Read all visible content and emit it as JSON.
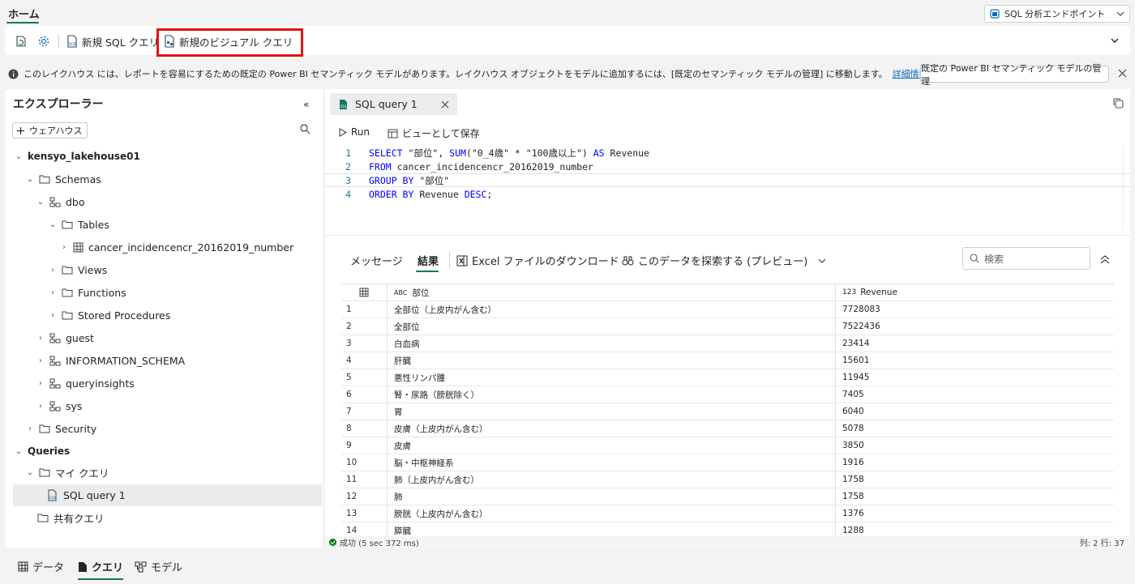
{
  "header": {
    "home_tab": "ホーム",
    "endpoint_label": "SQL 分析エンドポイント"
  },
  "ribbon": {
    "new_sql_query": "新規 SQL クエリ",
    "new_visual_query": "新規のビジュアル クエリ"
  },
  "info_bar": {
    "message": "このレイクハウス には、レポートを容易にするための既定の Power BI セマンティック モデルがあります。レイクハウス オブジェクトをモデルに追加するには、[既定のセマンティック モデルの管理] に移動します。",
    "learn_more": "詳細情報",
    "manage_button": "既定の Power BI セマンティック モデルの管理"
  },
  "explorer": {
    "title": "エクスプローラー",
    "add_warehouse": "ウェアハウス",
    "tree": {
      "lakehouse": "kensyo_lakehouse01",
      "schemas": "Schemas",
      "dbo": "dbo",
      "tables": "Tables",
      "table1": "cancer_incidencencr_20162019_number",
      "views": "Views",
      "functions": "Functions",
      "stored_procedures": "Stored Procedures",
      "guest": "guest",
      "information_schema": "INFORMATION_SCHEMA",
      "queryinsights": "queryinsights",
      "sys": "sys",
      "security": "Security",
      "queries": "Queries",
      "my_queries": "マイ クエリ",
      "sql_query1": "SQL query 1",
      "shared_queries": "共有クエリ"
    }
  },
  "editor": {
    "tab_title": "SQL query 1",
    "run": "Run",
    "save_as_view": "ビューとして保存",
    "code": {
      "l1_kw": "SELECT",
      "l1_a": " \"部位\", ",
      "l1_fn": "SUM",
      "l1_b": "(\"0_4歳\" * \"100歳以上\") ",
      "l1_as": "AS",
      "l1_c": " Revenue",
      "l2_kw": "FROM",
      "l2_a": " cancer_incidencencr_20162019_number",
      "l3_kw": "GROUP BY",
      "l3_a": " \"部位\"",
      "l4_kw": "ORDER BY",
      "l4_a": " Revenue ",
      "l4_desc": "DESC",
      "l4_b": ";"
    }
  },
  "results": {
    "tab_messages": "メッセージ",
    "tab_results": "結果",
    "excel_download": "Excel ファイルのダウンロード",
    "explore_data": "このデータを探索する (プレビュー)",
    "search_placeholder": "検索",
    "col_type1": "ABC",
    "col1": "部位",
    "col_type2": "123",
    "col2": "Revenue",
    "rows": [
      {
        "n": "1",
        "part": "全部位（上皮内がん含む）",
        "rev": "7728083"
      },
      {
        "n": "2",
        "part": "全部位",
        "rev": "7522436"
      },
      {
        "n": "3",
        "part": "白血病",
        "rev": "23414"
      },
      {
        "n": "4",
        "part": "肝臓",
        "rev": "15601"
      },
      {
        "n": "5",
        "part": "悪性リンパ腫",
        "rev": "11945"
      },
      {
        "n": "6",
        "part": "腎・尿路（膀胱除く）",
        "rev": "7405"
      },
      {
        "n": "7",
        "part": "胃",
        "rev": "6040"
      },
      {
        "n": "8",
        "part": "皮膚（上皮内がん含む）",
        "rev": "5078"
      },
      {
        "n": "9",
        "part": "皮膚",
        "rev": "3850"
      },
      {
        "n": "10",
        "part": "脳・中枢神経系",
        "rev": "1916"
      },
      {
        "n": "11",
        "part": "肺（上皮内がん含む）",
        "rev": "1758"
      },
      {
        "n": "12",
        "part": "肺",
        "rev": "1758"
      },
      {
        "n": "13",
        "part": "膀胱（上皮内がん含む）",
        "rev": "1376"
      },
      {
        "n": "14",
        "part": "膵臓",
        "rev": "1288"
      }
    ],
    "status": "成功 (5 sec 372 ms)",
    "position": "列: 2 行: 37"
  },
  "bottom_tabs": {
    "data": "データ",
    "query": "クエリ",
    "model": "モデル"
  }
}
